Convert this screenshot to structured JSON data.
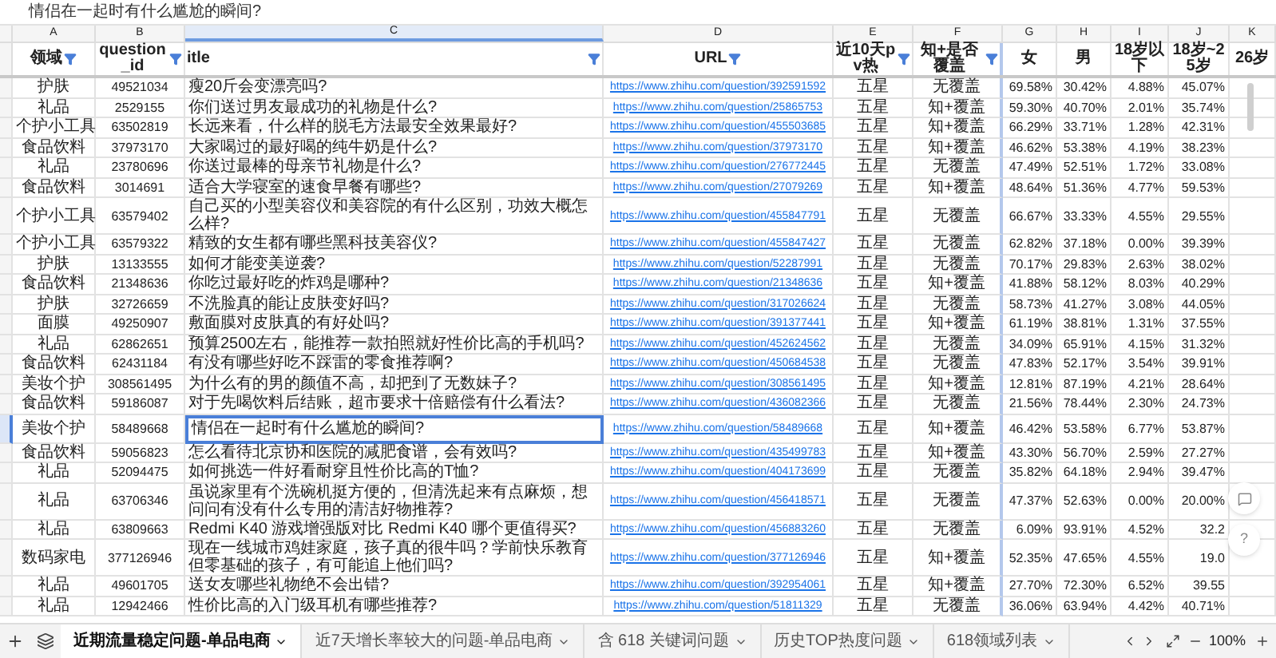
{
  "formula_bar": {
    "text": "情侣在一起时有什么尴尬的瞬间?"
  },
  "column_letters": [
    {
      "label": "A",
      "selected": false
    },
    {
      "label": "B",
      "selected": false
    },
    {
      "label": "C",
      "selected": true
    },
    {
      "label": "D",
      "selected": false
    },
    {
      "label": "E",
      "selected": false
    },
    {
      "label": "F",
      "selected": false
    },
    {
      "label": "G",
      "selected": false
    },
    {
      "label": "H",
      "selected": false
    },
    {
      "label": "I",
      "selected": false
    },
    {
      "label": "J",
      "selected": false
    },
    {
      "label": "K",
      "selected": false
    }
  ],
  "header": [
    {
      "label": "领域",
      "kind": "text",
      "filter": true
    },
    {
      "label": "question_id",
      "kind": "id",
      "filter": true
    },
    {
      "label": "itle",
      "kind": "title",
      "filter": true
    },
    {
      "label": "URL",
      "kind": "link",
      "filter": true
    },
    {
      "label": "近10天pv热",
      "kind": "text",
      "filter": true
    },
    {
      "label": "知+是否覆盖",
      "kind": "text",
      "filter": true
    },
    {
      "label": "女",
      "kind": "percent",
      "filter": false
    },
    {
      "label": "男",
      "kind": "percent",
      "filter": false
    },
    {
      "label": "18岁以下",
      "kind": "percent",
      "filter": false
    },
    {
      "label": "18岁~25岁",
      "kind": "percent",
      "filter": false
    },
    {
      "label": "26岁",
      "kind": "percent",
      "filter": false
    }
  ],
  "rows": [
    {
      "selected": false,
      "cells": [
        "护肤",
        "49521034",
        "瘦20斤会变漂亮吗?",
        "https://www.zhihu.com/question/392591592",
        "五星",
        "无覆盖",
        "69.58%",
        "30.42%",
        "4.88%",
        "45.07%"
      ]
    },
    {
      "selected": false,
      "cells": [
        "礼品",
        "2529155",
        "你们送过男友最成功的礼物是什么?",
        "https://www.zhihu.com/question/25865753",
        "五星",
        "知+覆盖",
        "59.30%",
        "40.70%",
        "2.01%",
        "35.74%"
      ]
    },
    {
      "selected": false,
      "cells": [
        "个护小工具",
        "63502819",
        "长远来看，什么样的脱毛方法最安全效果最好?",
        "https://www.zhihu.com/question/455503685",
        "五星",
        "知+覆盖",
        "66.29%",
        "33.71%",
        "1.28%",
        "42.31%"
      ]
    },
    {
      "selected": false,
      "cells": [
        "食品饮料",
        "37973170",
        "大家喝过的最好喝的纯牛奶是什么?",
        "https://www.zhihu.com/question/37973170",
        "五星",
        "知+覆盖",
        "46.62%",
        "53.38%",
        "4.19%",
        "38.23%"
      ]
    },
    {
      "selected": false,
      "cells": [
        "礼品",
        "23780696",
        "你送过最棒的母亲节礼物是什么?",
        "https://www.zhihu.com/question/276772445",
        "五星",
        "无覆盖",
        "47.49%",
        "52.51%",
        "1.72%",
        "33.08%"
      ]
    },
    {
      "selected": false,
      "cells": [
        "食品饮料",
        "3014691",
        "适合大学寝室的速食早餐有哪些?",
        "https://www.zhihu.com/question/27079269",
        "五星",
        "知+覆盖",
        "48.64%",
        "51.36%",
        "4.77%",
        "59.53%"
      ]
    },
    {
      "selected": false,
      "cells": [
        "个护小工具",
        "63579402",
        "自己买的小型美容仪和美容院的有什么区别，功效大概怎么样?",
        "https://www.zhihu.com/question/455847791",
        "五星",
        "无覆盖",
        "66.67%",
        "33.33%",
        "4.55%",
        "29.55%"
      ]
    },
    {
      "selected": false,
      "cells": [
        "个护小工具",
        "63579322",
        "精致的女生都有哪些黑科技美容仪?",
        "https://www.zhihu.com/question/455847427",
        "五星",
        "无覆盖",
        "62.82%",
        "37.18%",
        "0.00%",
        "39.39%"
      ]
    },
    {
      "selected": false,
      "cells": [
        "护肤",
        "13133555",
        "如何才能变美逆袭?",
        "https://www.zhihu.com/question/52287991",
        "五星",
        "无覆盖",
        "70.17%",
        "29.83%",
        "2.63%",
        "38.02%"
      ]
    },
    {
      "selected": false,
      "cells": [
        "食品饮料",
        "21348636",
        "你吃过最好吃的炸鸡是哪种?",
        "https://www.zhihu.com/question/21348636",
        "五星",
        "知+覆盖",
        "41.88%",
        "58.12%",
        "8.03%",
        "40.29%"
      ]
    },
    {
      "selected": false,
      "cells": [
        "护肤",
        "32726659",
        "不洗脸真的能让皮肤变好吗?",
        "https://www.zhihu.com/question/317026624",
        "五星",
        "无覆盖",
        "58.73%",
        "41.27%",
        "3.08%",
        "44.05%"
      ]
    },
    {
      "selected": false,
      "cells": [
        "面膜",
        "49250907",
        "敷面膜对皮肤真的有好处吗?",
        "https://www.zhihu.com/question/391377441",
        "五星",
        "知+覆盖",
        "61.19%",
        "38.81%",
        "1.31%",
        "37.55%"
      ]
    },
    {
      "selected": false,
      "cells": [
        "礼品",
        "62862651",
        "预算2500左右，能推荐一款拍照就好性价比高的手机吗?",
        "https://www.zhihu.com/question/452624562",
        "五星",
        "无覆盖",
        "34.09%",
        "65.91%",
        "4.15%",
        "31.32%"
      ]
    },
    {
      "selected": false,
      "cells": [
        "食品饮料",
        "62431184",
        "有没有哪些好吃不踩雷的零食推荐啊?",
        "https://www.zhihu.com/question/450684538",
        "五星",
        "无覆盖",
        "47.83%",
        "52.17%",
        "3.54%",
        "39.91%"
      ]
    },
    {
      "selected": false,
      "cells": [
        "美妆个护",
        "308561495",
        "为什么有的男的颜值不高，却把到了无数妹子?",
        "https://www.zhihu.com/question/308561495",
        "五星",
        "知+覆盖",
        "12.81%",
        "87.19%",
        "4.21%",
        "28.64%"
      ]
    },
    {
      "selected": false,
      "cells": [
        "食品饮料",
        "59186087",
        "对于先喝饮料后结账，超市要求十倍赔偿有什么看法?",
        "https://www.zhihu.com/question/436082366",
        "五星",
        "无覆盖",
        "21.56%",
        "78.44%",
        "2.30%",
        "24.73%"
      ]
    },
    {
      "selected": true,
      "cells": [
        "美妆个护",
        "58489668",
        "情侣在一起时有什么尴尬的瞬间?",
        "https://www.zhihu.com/question/58489668",
        "五星",
        "知+覆盖",
        "46.42%",
        "53.58%",
        "6.77%",
        "53.87%"
      ]
    },
    {
      "selected": false,
      "cells": [
        "食品饮料",
        "59056823",
        "怎么看待北京协和医院的减肥食谱，会有效吗?",
        "https://www.zhihu.com/question/435499783",
        "五星",
        "知+覆盖",
        "43.30%",
        "56.70%",
        "2.59%",
        "27.27%"
      ]
    },
    {
      "selected": false,
      "cells": [
        "礼品",
        "52094475",
        "如何挑选一件好看耐穿且性价比高的T恤?",
        "https://www.zhihu.com/question/404173699",
        "五星",
        "无覆盖",
        "35.82%",
        "64.18%",
        "2.94%",
        "39.47%"
      ]
    },
    {
      "selected": false,
      "cells": [
        "礼品",
        "63706346",
        "虽说家里有个洗碗机挺方便的，但清洗起来有点麻烦，想问问有没有什么专用的清洁好物推荐?",
        "https://www.zhihu.com/question/456418571",
        "五星",
        "无覆盖",
        "47.37%",
        "52.63%",
        "0.00%",
        "20.00%"
      ]
    },
    {
      "selected": false,
      "cells": [
        "礼品",
        "63809663",
        "Redmi K40 游戏增强版对比 Redmi K40 哪个更值得买?",
        "https://www.zhihu.com/question/456883260",
        "五星",
        "无覆盖",
        "6.09%",
        "93.91%",
        "4.52%",
        "32.2"
      ]
    },
    {
      "selected": false,
      "cells": [
        "数码家电",
        "377126946",
        "现在一线城市鸡娃家庭，孩子真的很牛吗？学前快乐教育但零基础的孩子，有可能追上他们吗?",
        "https://www.zhihu.com/question/377126946",
        "五星",
        "知+覆盖",
        "52.35%",
        "47.65%",
        "4.55%",
        "19.0"
      ]
    },
    {
      "selected": false,
      "cells": [
        "礼品",
        "49601705",
        "送女友哪些礼物绝不会出错?",
        "https://www.zhihu.com/question/392954061",
        "五星",
        "知+覆盖",
        "27.70%",
        "72.30%",
        "6.52%",
        "39.55"
      ]
    },
    {
      "selected": false,
      "cells": [
        "礼品",
        "12942466",
        "性价比高的入门级耳机有哪些推荐?",
        "https://www.zhihu.com/question/51811329",
        "五星",
        "无覆盖",
        "36.06%",
        "63.94%",
        "4.42%",
        "40.71%"
      ]
    }
  ],
  "help_button": {
    "label": "?"
  },
  "tabs": [
    {
      "label": "近期流量稳定问题-单品电商",
      "selected": true
    },
    {
      "label": "近7天增长率较大的问题-单品电商",
      "selected": false
    },
    {
      "label": "含 618 关键词问题",
      "selected": false
    },
    {
      "label": "历史TOP热度问题",
      "selected": false
    },
    {
      "label": "618领域列表",
      "selected": false
    }
  ],
  "zoom": {
    "label": "100%"
  }
}
